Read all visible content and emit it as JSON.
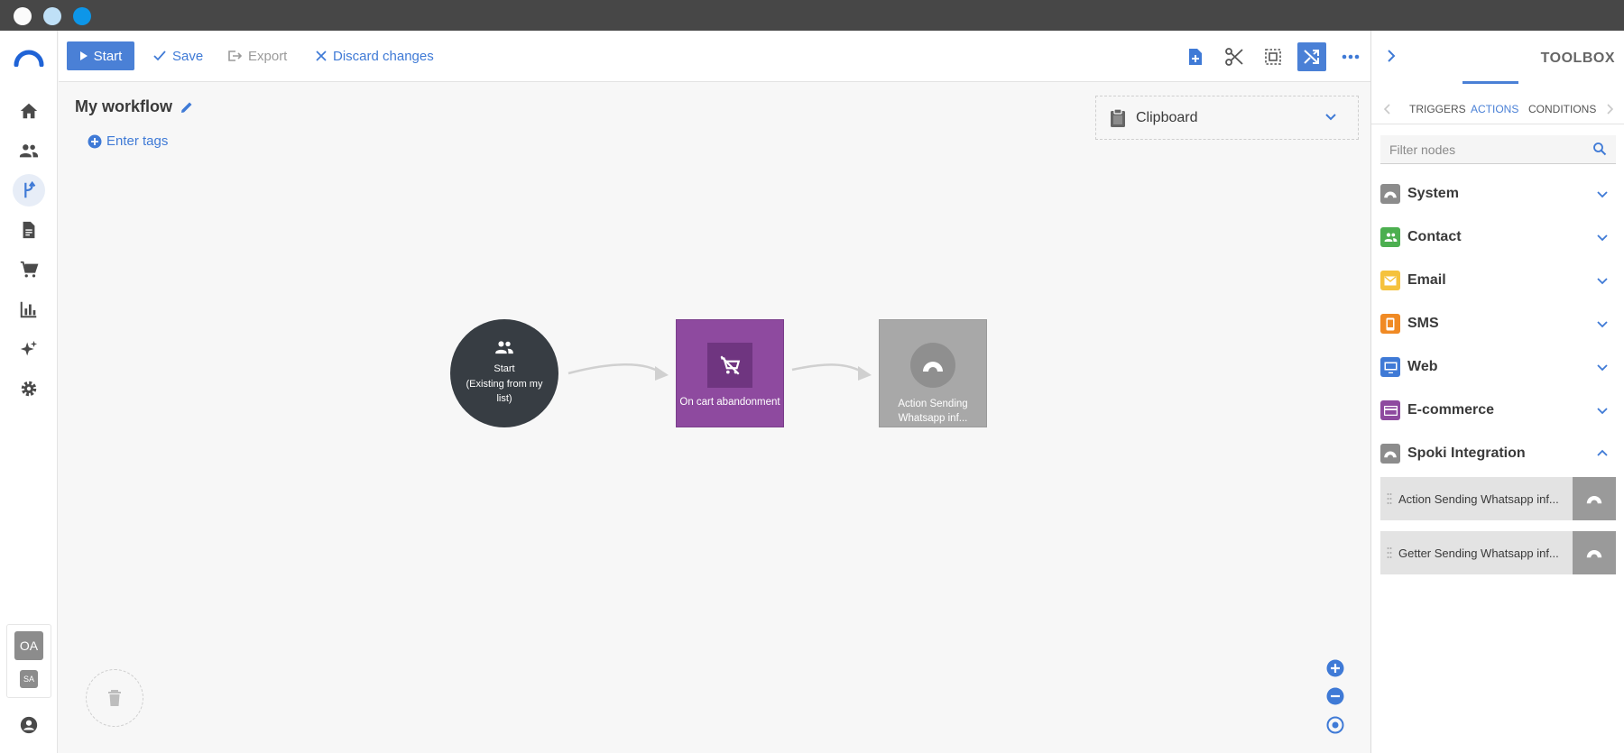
{
  "toolbar": {
    "start_label": "Start",
    "save_label": "Save",
    "export_label": "Export",
    "discard_label": "Discard changes"
  },
  "workflow": {
    "title": "My workflow",
    "tags_label": "Enter tags",
    "clipboard_label": "Clipboard"
  },
  "nodes": {
    "start": {
      "line1": "Start",
      "line2": "(Existing from my list)"
    },
    "cart": {
      "label": "On cart abandonment"
    },
    "action": {
      "label": "Action Sending Whatsapp inf..."
    }
  },
  "user": {
    "initials_primary": "OA",
    "initials_secondary": "SA"
  },
  "toolbox": {
    "title": "TOOLBOX",
    "tabs": [
      "TRIGGERS",
      "ACTIONS",
      "CONDITIONS"
    ],
    "active_tab": "ACTIONS",
    "filter_placeholder": "Filter nodes",
    "categories": [
      {
        "label": "System",
        "color": "#8c8c8c",
        "icon": "rainbow-icon"
      },
      {
        "label": "Contact",
        "color": "#4caf50",
        "icon": "people-icon"
      },
      {
        "label": "Email",
        "color": "#f5c23d",
        "icon": "envelope-icon"
      },
      {
        "label": "SMS",
        "color": "#f08a24",
        "icon": "phone-icon"
      },
      {
        "label": "Web",
        "color": "#3f7ad6",
        "icon": "monitor-icon"
      },
      {
        "label": "E-commerce",
        "color": "#8e4a9f",
        "icon": "card-icon"
      },
      {
        "label": "Spoki Integration",
        "color": "#8c8c8c",
        "icon": "rainbow-icon"
      }
    ],
    "spoki_nodes": [
      "Action Sending Whatsapp inf...",
      "Getter Sending Whatsapp inf..."
    ]
  },
  "colors": {
    "accent": "#4a80d6",
    "start_node": "#373d43",
    "cart_node": "#8e4a9f",
    "action_node": "#a8a8a8"
  }
}
